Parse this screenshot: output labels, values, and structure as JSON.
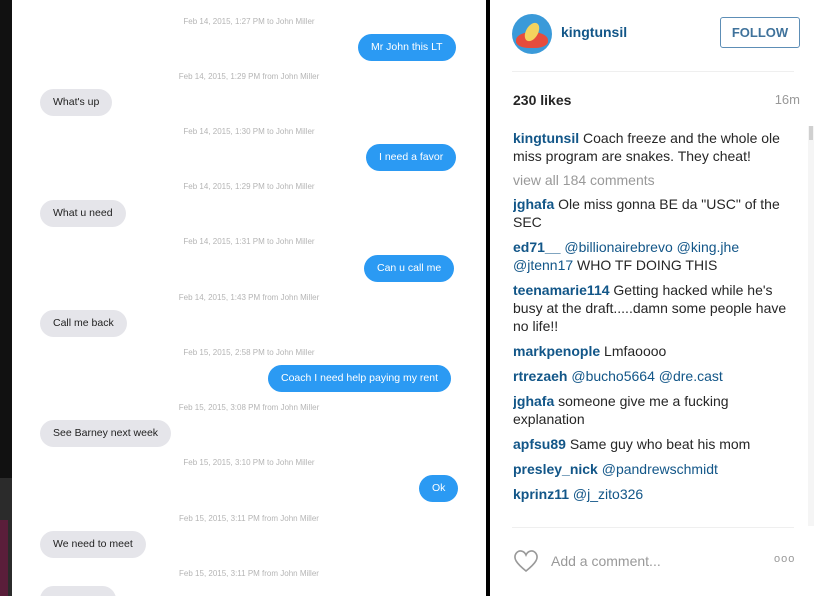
{
  "conversation": {
    "messages": [
      {
        "timestamp": "Feb 14, 2015, 1:27 PM to John Miller",
        "text": "Mr John this LT",
        "dir": "sent"
      },
      {
        "timestamp": "Feb 14, 2015, 1:29 PM from John Miller",
        "text": "What's up",
        "dir": "recv"
      },
      {
        "timestamp": "Feb 14, 2015, 1:30 PM to John Miller",
        "text": "I need a favor",
        "dir": "sent"
      },
      {
        "timestamp": "Feb 14, 2015, 1:29 PM to John Miller",
        "text": "What u need",
        "dir": "recv"
      },
      {
        "timestamp": "Feb 14, 2015, 1:31 PM to John Miller",
        "text": "Can u call me",
        "dir": "sent"
      },
      {
        "timestamp": "Feb 14, 2015, 1:43 PM from John Miller",
        "text": "Call me back",
        "dir": "recv"
      },
      {
        "timestamp": "Feb 15, 2015, 2:58 PM to John Miller",
        "text": "Coach I need help paying my rent",
        "dir": "sent"
      },
      {
        "timestamp": "Feb 15, 2015, 3:08 PM from John Miller",
        "text": "See Barney next week",
        "dir": "recv"
      },
      {
        "timestamp": "Feb 15, 2015, 3:10 PM to John Miller",
        "text": "Ok",
        "dir": "sent"
      },
      {
        "timestamp": "Feb 15, 2015, 3:11 PM from John Miller",
        "text": "We need to meet",
        "dir": "recv"
      },
      {
        "timestamp": "Feb 15, 2015, 3:11 PM from John Miller",
        "text": "",
        "dir": "recv"
      }
    ]
  },
  "post": {
    "username": "kingtunsil",
    "follow_label": "FOLLOW",
    "likes": "230 likes",
    "time": "16m",
    "caption_user": "kingtunsil",
    "caption_text": "Coach freeze and the whole ole miss program are snakes. They cheat!",
    "view_all": "view all 184 comments",
    "add_comment_placeholder": "Add a comment...",
    "more": "ooo"
  },
  "comments": [
    {
      "user": "jghafa",
      "parts": [
        {
          "t": "Ole miss gonna BE da \"USC\" of the SEC",
          "mention": false
        }
      ]
    },
    {
      "user": "ed71__",
      "parts": [
        {
          "t": "@billionairebrevo @king.jhe @jtenn17",
          "mention": true
        },
        {
          "t": " WHO TF DOING THIS",
          "mention": false
        }
      ]
    },
    {
      "user": "teenamarie114",
      "parts": [
        {
          "t": "Getting hacked while he's busy at the draft.....damn some people have no life!!",
          "mention": false
        }
      ]
    },
    {
      "user": "markpenople",
      "parts": [
        {
          "t": "Lmfaoooo",
          "mention": false
        }
      ]
    },
    {
      "user": "rtrezaeh",
      "parts": [
        {
          "t": "@bucho5664 @dre.cast",
          "mention": true
        }
      ]
    },
    {
      "user": "jghafa",
      "parts": [
        {
          "t": "someone give me a fucking explanation",
          "mention": false
        }
      ]
    },
    {
      "user": "apfsu89",
      "parts": [
        {
          "t": "Same guy who beat his mom",
          "mention": false
        }
      ]
    },
    {
      "user": "presley_nick",
      "parts": [
        {
          "t": "@pandrewschmidt",
          "mention": true
        }
      ]
    },
    {
      "user": "kprinz11",
      "parts": [
        {
          "t": "@j_zito326",
          "mention": true
        }
      ]
    }
  ],
  "colors": {
    "sent": "#2b9af3",
    "received": "#e5e5ea",
    "link": "#125688"
  },
  "icons": [
    "heart-icon",
    "more-options-icon"
  ]
}
